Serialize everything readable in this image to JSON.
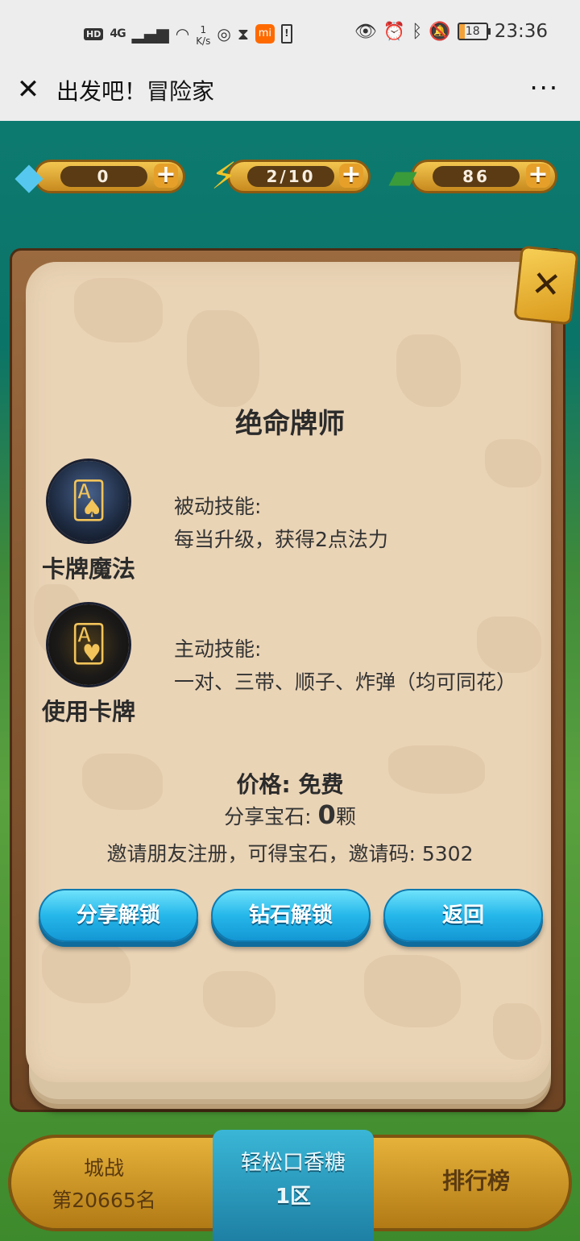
{
  "status_bar": {
    "hd": "HD",
    "signal": "4G",
    "speed_value": "1",
    "speed_unit": "K/s",
    "battery": "18",
    "time": "23:36"
  },
  "titlebar": {
    "title": "出发吧！冒险家",
    "more": "···"
  },
  "resources": {
    "gems": "0",
    "energy": "2/10",
    "cash": "86"
  },
  "dialog": {
    "title": "绝命牌师",
    "skills": [
      {
        "name": "卡牌魔法",
        "type": "被动技能:",
        "desc": "每当升级，获得2点法力"
      },
      {
        "name": "使用卡牌",
        "type": "主动技能:",
        "desc": "一对、三带、顺子、炸弹（均可同花）"
      }
    ],
    "price": "价格: 免费",
    "share_prefix": "分享宝石: ",
    "share_count": "0",
    "share_suffix": "颗",
    "invite": "邀请朋友注册，可得宝石，邀请码: 5302",
    "buttons": {
      "share": "分享解锁",
      "diamond": "钻石解锁",
      "back": "返回"
    }
  },
  "bottom_bar": {
    "left_title": "城战",
    "left_rank": "第20665名",
    "mid_title": "轻松口香糖",
    "mid_zone": "1区",
    "right": "排行榜"
  },
  "icons": {
    "gem": "gem-icon",
    "energy": "lightning-icon",
    "cash": "cash-icon",
    "close": "close-icon"
  },
  "colors": {
    "button_blue": "#25b7ea",
    "parchment": "#ead4b6",
    "frame_brown": "#6d4423",
    "resource_gold": "#e6a02a"
  }
}
